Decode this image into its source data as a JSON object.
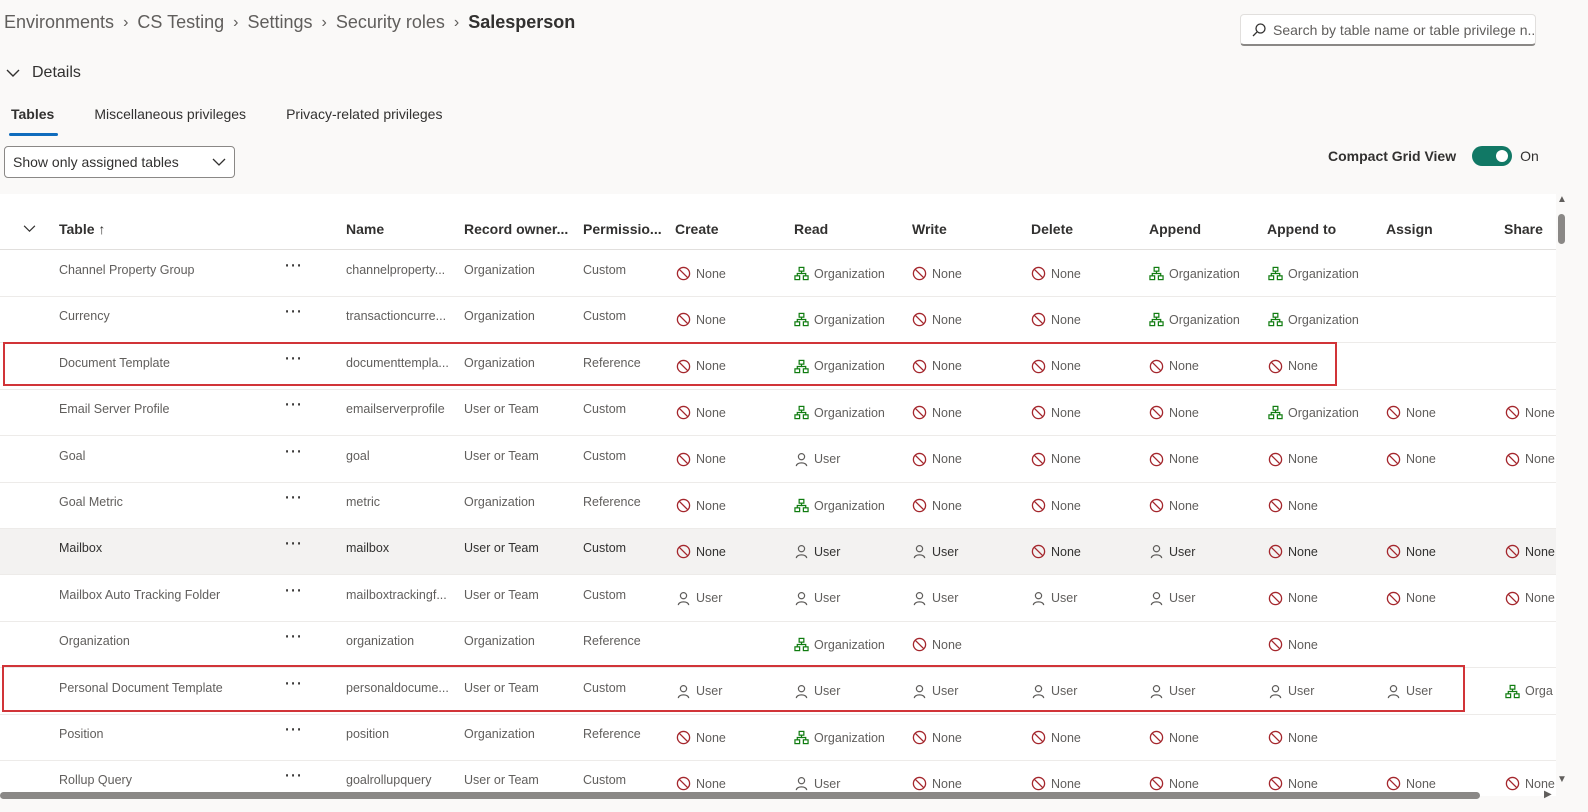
{
  "breadcrumb": [
    "Environments",
    "CS Testing",
    "Settings",
    "Security roles"
  ],
  "breadcrumb_current": "Salesperson",
  "search": {
    "placeholder": "Search by table name or table privilege n..."
  },
  "details": {
    "label": "Details"
  },
  "tabs": [
    "Tables",
    "Miscellaneous privileges",
    "Privacy-related privileges"
  ],
  "filter": {
    "value": "Show only assigned tables"
  },
  "compact": {
    "label": "Compact Grid View",
    "state": "On"
  },
  "columns": {
    "table": "Table",
    "table_sort": "↑",
    "name": "Name",
    "owner": "Record owner...",
    "permission": "Permissio...",
    "create": "Create",
    "read": "Read",
    "write": "Write",
    "delete": "Delete",
    "append": "Append",
    "append_to": "Append to",
    "assign": "Assign",
    "share": "Share"
  },
  "more_icon": "⋯",
  "rows": [
    {
      "table": "Channel Property Group",
      "name": "channelproperty...",
      "owner": "Organization",
      "perm": "Custom",
      "create": "None",
      "read": "Organization",
      "write": "None",
      "delete": "None",
      "append": "Organization",
      "append_to": "Organization",
      "assign": "",
      "share": ""
    },
    {
      "table": "Currency",
      "name": "transactioncurre...",
      "owner": "Organization",
      "perm": "Custom",
      "create": "None",
      "read": "Organization",
      "write": "None",
      "delete": "None",
      "append": "Organization",
      "append_to": "Organization",
      "assign": "",
      "share": ""
    },
    {
      "table": "Document Template",
      "name": "documenttempla...",
      "owner": "Organization",
      "perm": "Reference",
      "create": "None",
      "read": "Organization",
      "write": "None",
      "delete": "None",
      "append": "None",
      "append_to": "None",
      "assign": "",
      "share": ""
    },
    {
      "table": "Email Server Profile",
      "name": "emailserverprofile",
      "owner": "User or Team",
      "perm": "Custom",
      "create": "None",
      "read": "Organization",
      "write": "None",
      "delete": "None",
      "append": "None",
      "append_to": "Organization",
      "assign": "None",
      "share": "None"
    },
    {
      "table": "Goal",
      "name": "goal",
      "owner": "User or Team",
      "perm": "Custom",
      "create": "None",
      "read": "User",
      "write": "None",
      "delete": "None",
      "append": "None",
      "append_to": "None",
      "assign": "None",
      "share": "None"
    },
    {
      "table": "Goal Metric",
      "name": "metric",
      "owner": "Organization",
      "perm": "Reference",
      "create": "None",
      "read": "Organization",
      "write": "None",
      "delete": "None",
      "append": "None",
      "append_to": "None",
      "assign": "",
      "share": ""
    },
    {
      "table": "Mailbox",
      "name": "mailbox",
      "owner": "User or Team",
      "perm": "Custom",
      "create": "None",
      "read": "User",
      "write": "User",
      "delete": "None",
      "append": "User",
      "append_to": "None",
      "assign": "None",
      "share": "None"
    },
    {
      "table": "Mailbox Auto Tracking Folder",
      "name": "mailboxtrackingf...",
      "owner": "User or Team",
      "perm": "Custom",
      "create": "User",
      "read": "User",
      "write": "User",
      "delete": "User",
      "append": "User",
      "append_to": "None",
      "assign": "None",
      "share": "None"
    },
    {
      "table": "Organization",
      "name": "organization",
      "owner": "Organization",
      "perm": "Reference",
      "create": "",
      "read": "Organization",
      "write": "None",
      "delete": "",
      "append": "",
      "append_to": "None",
      "assign": "",
      "share": ""
    },
    {
      "table": "Personal Document Template",
      "name": "personaldocume...",
      "owner": "User or Team",
      "perm": "Custom",
      "create": "User",
      "read": "User",
      "write": "User",
      "delete": "User",
      "append": "User",
      "append_to": "User",
      "assign": "User",
      "share": "Orga"
    },
    {
      "table": "Position",
      "name": "position",
      "owner": "Organization",
      "perm": "Reference",
      "create": "None",
      "read": "Organization",
      "write": "None",
      "delete": "None",
      "append": "None",
      "append_to": "None",
      "assign": "",
      "share": ""
    },
    {
      "table": "Rollup Query",
      "name": "goalrollupquery",
      "owner": "User or Team",
      "perm": "Custom",
      "create": "None",
      "read": "User",
      "write": "None",
      "delete": "None",
      "append": "None",
      "append_to": "None",
      "assign": "None",
      "share": "None"
    }
  ],
  "highlighted_row": "Mailbox",
  "colors": {
    "none": "#a4262c",
    "organization": "#107c10",
    "user": "#605e5c",
    "accent": "#0f6cbd",
    "toggle": "#117865",
    "highlight_box": "#d13438"
  },
  "icons": {
    "None": "blocked-icon",
    "Organization": "org-chart-icon",
    "User": "person-icon"
  }
}
